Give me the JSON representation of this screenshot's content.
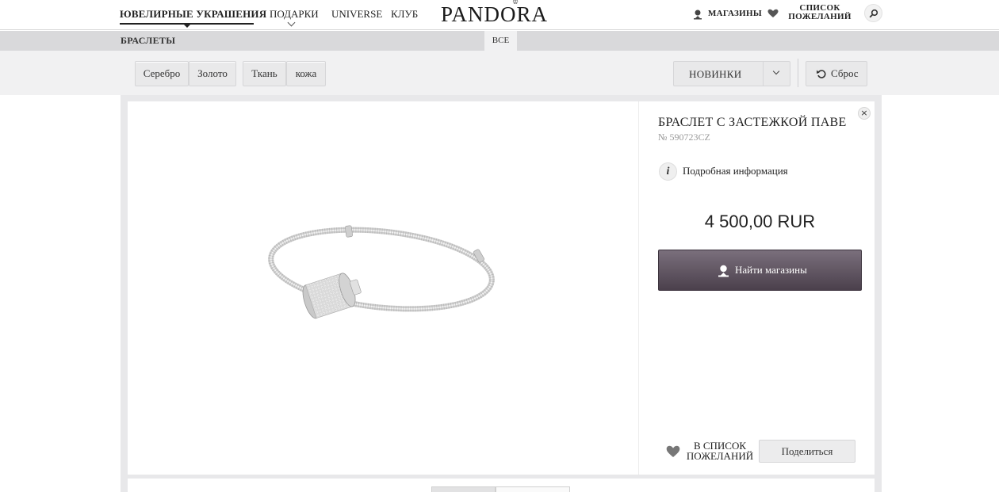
{
  "header": {
    "nav": {
      "jewelry": "ЮВЕЛИРНЫЕ УКРАШЕНИЯ",
      "gifts": "ПОДАРКИ",
      "universe": "UNIVERSE",
      "club": "КЛУБ"
    },
    "logo": "PANDORA",
    "stores": "МАГАЗИНЫ",
    "wishlist_line1": "СПИСОК",
    "wishlist_line2": "ПОЖЕЛАНИЙ"
  },
  "category": {
    "title": "БРАСЛЕТЫ",
    "tab_all": "ВСЕ"
  },
  "filters": {
    "materials": [
      "Серебро",
      "Золото",
      "Ткань",
      "кожа"
    ],
    "sort_value": "НОВИНКИ",
    "reset_label": "Сброс"
  },
  "product": {
    "close": "×",
    "title": "БРАСЛЕТ С ЗАСТЕЖКОЙ ПАВЕ",
    "sku": "№ 590723CZ",
    "info_icon": "i",
    "info_label": "Подробная информация",
    "price": "4 500,00 RUR",
    "find_stores": "Найти магазины",
    "wishlist_line1": "В СПИСОК",
    "wishlist_line2": "ПОЖЕЛАНИЙ",
    "share": "Поделиться"
  },
  "colors": {
    "accent_button": "#5a4f5b",
    "filter_bg": "#f1f1f2",
    "category_bar": "#d9d9db"
  }
}
